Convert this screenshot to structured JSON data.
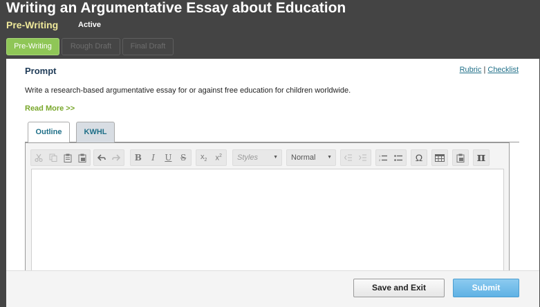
{
  "header": {
    "title": "Writing an Argumentative Essay about Education",
    "stage": "Pre-Writing",
    "status": "Active"
  },
  "stage_tabs": [
    {
      "label": "Pre-Writing",
      "active": true
    },
    {
      "label": "Rough Draft",
      "active": false
    },
    {
      "label": "Final Draft",
      "active": false
    }
  ],
  "prompt": {
    "heading": "Prompt",
    "rubric_link": "Rubric",
    "separator": "|",
    "checklist_link": "Checklist",
    "text": "Write a research-based argumentative essay for or against free education for children worldwide.",
    "read_more": "Read More >>"
  },
  "editor_tabs": [
    {
      "label": "Outline",
      "active": true
    },
    {
      "label": "KWHL",
      "active": false
    }
  ],
  "toolbar": {
    "styles_placeholder": "Styles",
    "format_value": "Normal",
    "omega_glyph": "Ω",
    "pi_glyph": "π"
  },
  "footer": {
    "save_label": "Save and Exit",
    "submit_label": "Submit"
  },
  "colors": {
    "background": "#444444",
    "active_tab": "#8fc657",
    "stage_text": "#eee89a",
    "submit": "#5fb2e4",
    "link": "#1f6f88"
  }
}
